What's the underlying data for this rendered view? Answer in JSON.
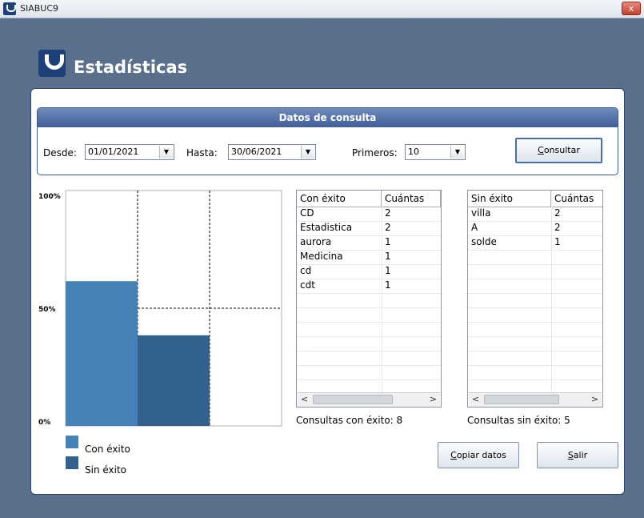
{
  "window": {
    "title": "SIABUC9",
    "close_label": "x"
  },
  "header": {
    "title": "Estadísticas"
  },
  "query": {
    "title": "Datos de consulta",
    "desde_label": "Desde:",
    "desde_value": "01/01/2021",
    "hasta_label": "Hasta:",
    "hasta_value": "30/06/2021",
    "primeros_label": "Primeros:",
    "primeros_value": "10",
    "consultar_first": "C",
    "consultar_rest": "onsultar"
  },
  "chart_data": {
    "type": "bar",
    "categories": [
      "Con éxito",
      "Sin éxito"
    ],
    "values": [
      61.5,
      38.5
    ],
    "ylim": [
      0,
      100
    ],
    "yticks": [
      "0%",
      "50%",
      "100%"
    ],
    "colors": [
      "#4681b8",
      "#31618c"
    ],
    "legend": [
      {
        "label": "Con éxito",
        "color": "#4681b8"
      },
      {
        "label": "Sin éxito",
        "color": "#31618c"
      }
    ],
    "grid": true,
    "legend_position": "bottom-left"
  },
  "success_table": {
    "headers": [
      "Con éxito",
      "Cuántas"
    ],
    "rows": [
      [
        "CD",
        "2"
      ],
      [
        "Estadistica",
        "2"
      ],
      [
        "aurora",
        "1"
      ],
      [
        "Medicina",
        "1"
      ],
      [
        "cd",
        "1"
      ],
      [
        "cdt",
        "1"
      ]
    ],
    "footer": "Consultas con éxito: 8"
  },
  "fail_table": {
    "headers": [
      "Sin éxito",
      "Cuántas"
    ],
    "rows": [
      [
        "villa",
        "2"
      ],
      [
        "A",
        "2"
      ],
      [
        "solde",
        "1"
      ]
    ],
    "footer": "Consultas sin éxito: 5"
  },
  "actions": {
    "copiar_first": "C",
    "copiar_rest": "opiar datos",
    "salir_first": "S",
    "salir_rest": "alir"
  },
  "colors": {
    "background": "#5a6f8c",
    "accent": "#40609b"
  }
}
